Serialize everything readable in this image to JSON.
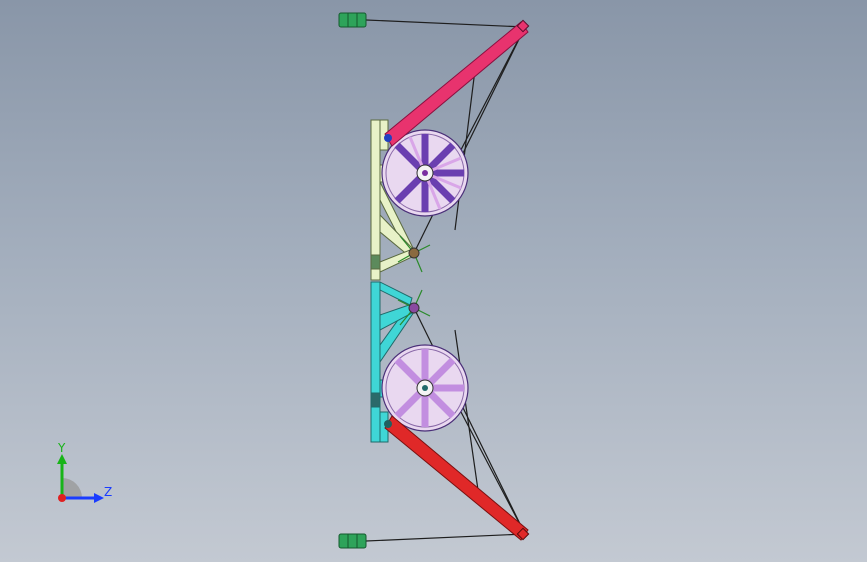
{
  "viewport": {
    "colors": {
      "frame_upper": "#e8f2c8",
      "frame_lower": "#3fd6d6",
      "boom_upper": "#e8336e",
      "boom_lower": "#e02828",
      "counterweight": "#2ea35a",
      "wheel_hub": "#6a3fb0",
      "wheel_spoke": "#d9a6e8",
      "cable": "#1e1e1e"
    }
  },
  "triad": {
    "y_label": "Y",
    "z_label": "Z",
    "colors": {
      "y": "#18b418",
      "z": "#1a3cff",
      "origin": "#e02020"
    }
  }
}
